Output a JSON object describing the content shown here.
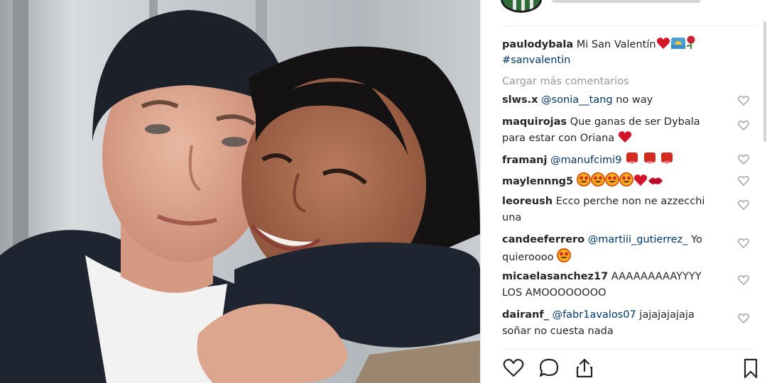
{
  "post": {
    "caption": {
      "username": "paulodybala",
      "text": "Mi San Valentín",
      "emojis": [
        "heart-emoji",
        "sunrise-emoji",
        "rose-emoji"
      ],
      "hashtag": "#sanvalentin"
    },
    "load_more": "Cargar más comentarios",
    "comments": [
      {
        "username": "slws.x",
        "mention": "@sonia__tang",
        "text": " no way",
        "emojis": []
      },
      {
        "username": "maquirojas",
        "mention": "",
        "text": " Que ganas de ser Dybala para estar con Oriana",
        "emojis": [
          "heart-emoji"
        ]
      },
      {
        "username": "framanj",
        "mention": "@manufcimi9",
        "text": "",
        "emojis": [
          "tongue-emoji",
          "tongue-emoji",
          "tongue-emoji"
        ]
      },
      {
        "username": "maylennng5",
        "mention": "",
        "text": "",
        "emojis": [
          "star-eyes-emoji",
          "star-eyes-emoji",
          "star-eyes-emoji",
          "star-eyes-emoji",
          "heart-emoji",
          "kiss-lips-emoji"
        ]
      },
      {
        "username": "leoreush",
        "mention": "",
        "text": " Ecco perche non ne azzecchi una",
        "emojis": []
      },
      {
        "username": "candeeferrero",
        "mention": "@martiii_gutierrez_",
        "text": " Yo quieroooo",
        "emojis": [
          "star-eyes-emoji"
        ]
      },
      {
        "username": "micaelasanchez17",
        "mention": "",
        "text": " AAAAAAAAAYYYY LOS AMOOOOOOOO",
        "emojis": []
      },
      {
        "username": "dairanf_",
        "mention": "@fabr1avalos07",
        "text": " jajajajajaja soñar no cuesta nada",
        "emojis": []
      }
    ]
  },
  "actions": {
    "like": "heart-outline-icon",
    "comment": "comment-bubble-icon",
    "share": "share-upload-icon",
    "save": "bookmark-icon"
  },
  "colors": {
    "text": "#262626",
    "mention": "#003569",
    "muted": "#999999",
    "heart_red": "#d3152c",
    "divider": "#efefef"
  }
}
